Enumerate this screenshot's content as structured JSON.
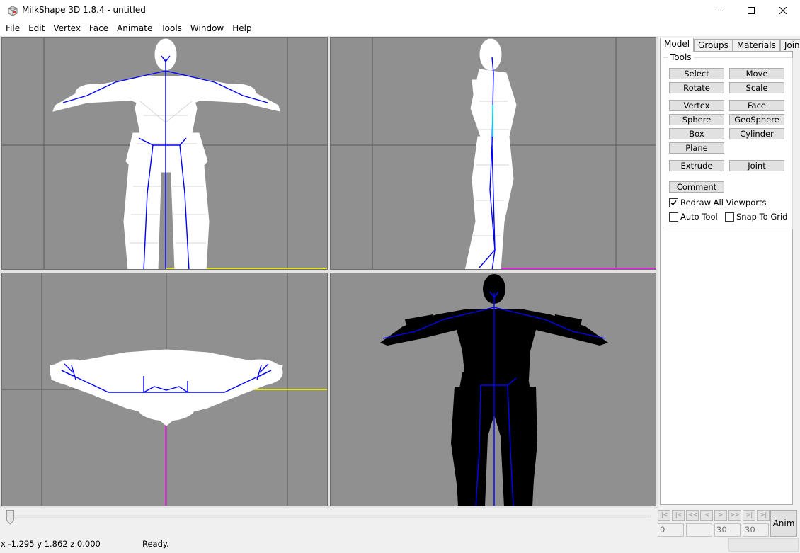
{
  "window": {
    "title": "MilkShape 3D 1.8.4 - untitled",
    "controls": [
      "minimize-icon",
      "maximize-icon",
      "close-icon"
    ]
  },
  "menu": [
    "File",
    "Edit",
    "Vertex",
    "Face",
    "Animate",
    "Tools",
    "Window",
    "Help"
  ],
  "viewports": {
    "background": "#909090",
    "wire_color": "#ffffff",
    "bone_color": "#0000ff",
    "axis_x_color": "#ffff00",
    "axis_z_color": "#ff00ff",
    "solid_color": "#000000"
  },
  "panel": {
    "tabs": [
      {
        "label": "Model",
        "active": true
      },
      {
        "label": "Groups",
        "active": false
      },
      {
        "label": "Materials",
        "active": false
      },
      {
        "label": "Joints",
        "active": false
      }
    ],
    "group_label": "Tools",
    "buttons": {
      "select": "Select",
      "move": "Move",
      "rotate": "Rotate",
      "scale": "Scale",
      "vertex": "Vertex",
      "face": "Face",
      "sphere": "Sphere",
      "geosphere": "GeoSphere",
      "box": "Box",
      "cylinder": "Cylinder",
      "plane": "Plane",
      "extrude": "Extrude",
      "joint": "Joint",
      "comment": "Comment"
    },
    "checkboxes": [
      {
        "label": "Redraw All Viewports",
        "checked": true
      },
      {
        "label": "Auto Tool",
        "checked": false
      },
      {
        "label": "Snap To Grid",
        "checked": false
      }
    ]
  },
  "timeline": {
    "nav_buttons": [
      "|<",
      "|<",
      "<<",
      "<",
      ">",
      ">>",
      ">|",
      ">|"
    ],
    "frame_fields": [
      "0",
      "",
      "30",
      "30"
    ],
    "anim_button": "Anim"
  },
  "status": {
    "coords": "x -1.295 y 1.862 z 0.000",
    "message": "Ready."
  }
}
